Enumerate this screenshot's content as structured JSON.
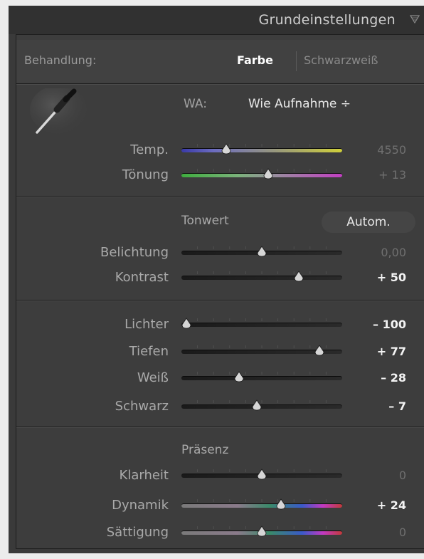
{
  "panel": {
    "title": "Grundeinstellungen"
  },
  "treatment": {
    "label": "Behandlung:",
    "option_color": "Farbe",
    "option_bw": "Schwarzweiß"
  },
  "white_balance": {
    "label": "WA:",
    "value": "Wie Aufnahme ÷"
  },
  "sliders_wb": [
    {
      "label": "Temp.",
      "value": "4550",
      "position": 0.28,
      "track": "temp"
    },
    {
      "label": "Tönung",
      "value": "+ 13",
      "position": 0.54,
      "track": "tint"
    }
  ],
  "tone": {
    "title": "Tonwert",
    "auto_label": "Autom."
  },
  "sliders_tone": [
    {
      "label": "Belichtung",
      "value": "0,00",
      "position": 0.5,
      "bright": false
    },
    {
      "label": "Kontrast",
      "value": "+ 50",
      "position": 0.73,
      "bright": true
    }
  ],
  "sliders_tone2": [
    {
      "label": "Lichter",
      "value": "– 100",
      "position": 0.03,
      "bright": true
    },
    {
      "label": "Tiefen",
      "value": "+ 77",
      "position": 0.86,
      "bright": true
    },
    {
      "label": "Weiß",
      "value": "– 28",
      "position": 0.36,
      "bright": true
    },
    {
      "label": "Schwarz",
      "value": "– 7",
      "position": 0.47,
      "bright": true
    }
  ],
  "presence": {
    "title": "Präsenz"
  },
  "sliders_presence": [
    {
      "label": "Klarheit",
      "value": "0",
      "position": 0.5,
      "bright": false,
      "track": "gray"
    },
    {
      "label": "Dynamik",
      "value": "+ 24",
      "position": 0.62,
      "bright": true,
      "track": "color"
    },
    {
      "label": "Sättigung",
      "value": "0",
      "position": 0.5,
      "bright": false,
      "track": "color"
    }
  ],
  "colors": {
    "panel_bg": "#3d3d3d",
    "header_bg": "#313131",
    "text": "#a9a9a9",
    "value_bright": "#f3f3f3"
  }
}
